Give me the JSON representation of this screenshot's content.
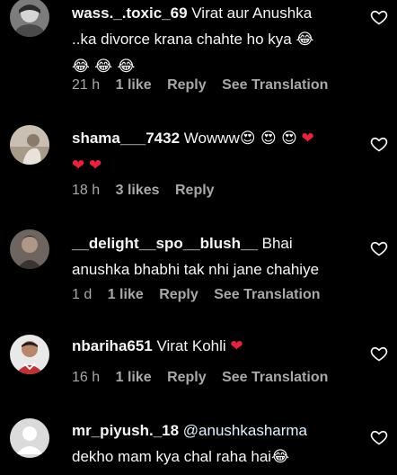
{
  "comments": [
    {
      "username": "wass._.toxic_69",
      "text_line1": "Virat aur Anushka",
      "text_line2": "..ka divorce krana chahte ho kya",
      "emoji_inline": "😂",
      "emoji_line": "😂 😂 😂",
      "time": "21 h",
      "likes": "1 like",
      "reply": "Reply",
      "translation": "See Translation"
    },
    {
      "username": "shama___7432",
      "text": "Wowww",
      "emoji_inline": "😍 😍 😍",
      "heart_emoji": "❤",
      "time": "18 h",
      "likes": "3 likes",
      "reply": "Reply"
    },
    {
      "username": "__delight__spo__blush__",
      "text_line1": "Bhai",
      "text_line2": "anushka bhabhi tak nhi jane chahiye",
      "time": "1 d",
      "likes": "1 like",
      "reply": "Reply",
      "translation": "See Translation"
    },
    {
      "username": "nbariha651",
      "text": "Virat Kohli",
      "heart_emoji": "❤",
      "time": "16 h",
      "likes": "1 like",
      "reply": "Reply",
      "translation": "See Translation"
    },
    {
      "username": "mr_piyush._18",
      "mention": "@anushkasharma",
      "text_line2": "dekho mam kya chal raha hai",
      "emoji_inline": "😂"
    }
  ],
  "colors": {
    "background": "#000000",
    "text": "#f5f5f5",
    "secondary": "#a8a8a8",
    "heart": "#ed1f3b",
    "mention": "#e0f1ff"
  }
}
